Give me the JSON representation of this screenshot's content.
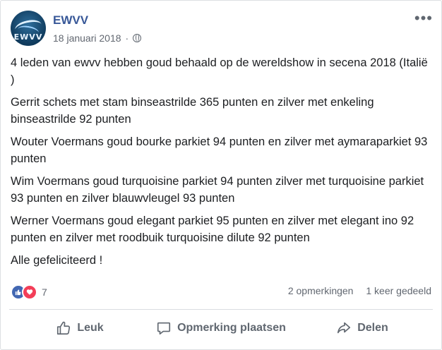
{
  "post": {
    "page_name": "EWVV",
    "avatar_text": "EWVV",
    "date": "18 januari 2018",
    "separator": "·",
    "more_glyph": "•••",
    "paragraphs": [
      "4 leden van ewvv hebben goud behaald op de wereldshow in secena 2018 (Italië )",
      "Gerrit schets met stam binseastrilde 365 punten en zilver met enkeling binseastrilde 92 punten",
      "Wouter Voermans goud bourke parkiet 94 punten en zilver met aymaraparkiet 93 punten",
      "Wim Voermans goud turquoisine parkiet 94 punten zilver met turquoisine parkiet 93 punten en zilver blauwvleugel 93 punten",
      "Werner Voermans goud elegant parkiet 95 punten en zilver met elegant ino 92 punten en zilver met roodbuik turquoisine dilute 92 punten",
      "Alle gefeliciteerd !"
    ]
  },
  "stats": {
    "reaction_count": "7",
    "comments": "2 opmerkingen",
    "shares": "1 keer gedeeld"
  },
  "actions": {
    "like": "Leuk",
    "comment": "Opmerking plaatsen",
    "share": "Delen"
  },
  "colors": {
    "link": "#385898",
    "like_blue": "#4267b2",
    "love_red": "#f33e58",
    "muted": "#606770"
  }
}
